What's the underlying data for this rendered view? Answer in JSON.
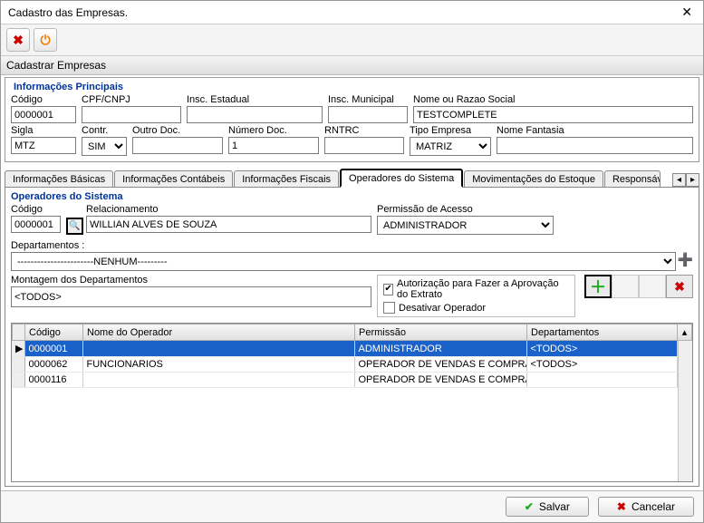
{
  "window": {
    "title": "Cadastro das Empresas."
  },
  "section_header": "Cadastrar Empresas",
  "fieldset_main": {
    "legend": "Informações Principais"
  },
  "labels": {
    "codigo": "Código",
    "cpf_cnpj": "CPF/CNPJ",
    "insc_estadual": "Insc. Estadual",
    "insc_municipal": "Insc. Municipal",
    "nome_razao": "Nome ou Razao Social",
    "sigla": "Sigla",
    "contr": "Contr.",
    "outro_doc": "Outro Doc.",
    "numero_doc": "Número Doc.",
    "rntrc": "RNTRC",
    "tipo_empresa": "Tipo Empresa",
    "nome_fantasia": "Nome Fantasia"
  },
  "values": {
    "codigo": "0000001",
    "cpf_cnpj": "",
    "insc_estadual": "",
    "insc_municipal": "",
    "nome_razao": "TESTCOMPLETE",
    "sigla": "MTZ",
    "contr": "SIM",
    "outro_doc": "",
    "numero_doc": "1",
    "rntrc": "",
    "tipo_empresa": "MATRIZ",
    "nome_fantasia": ""
  },
  "tabs": {
    "t1": "Informações Básicas",
    "t2": "Informações Contábeis",
    "t3": "Informações Fiscais",
    "t4": "Operadores do Sistema",
    "t5": "Movimentações do Estoque",
    "t6": "Responsáv"
  },
  "operators": {
    "legend": "Operadores do Sistema",
    "lbl_codigo": "Código",
    "lbl_relacionamento": "Relacionamento",
    "lbl_permissao": "Permissão de Acesso",
    "lbl_departamentos": "Departamentos :",
    "lbl_montagem": "Montagem dos Departamentos",
    "codigo": "0000001",
    "relacionamento": "WILLIAN ALVES DE SOUZA",
    "permissao": "ADMINISTRADOR",
    "departamento": "-----------------------NENHUM---------",
    "montagem": "<TODOS>",
    "chk_autorizacao_label": "Autorização para Fazer a Aprovação do Extrato",
    "chk_autorizacao_checked": true,
    "chk_desativar_label": "Desativar Operador",
    "chk_desativar_checked": false
  },
  "grid": {
    "headers": {
      "codigo": "Código",
      "nome": "Nome do Operador",
      "permissao": "Permissão",
      "departamentos": "Departamentos"
    },
    "rows": [
      {
        "codigo": "0000001",
        "nome": "",
        "permissao": "ADMINISTRADOR",
        "departamentos": "<TODOS>",
        "selected": true
      },
      {
        "codigo": "0000062",
        "nome": "FUNCIONARIOS",
        "permissao": "OPERADOR DE VENDAS E COMPRAS",
        "departamentos": "<TODOS>",
        "selected": false
      },
      {
        "codigo": "0000116",
        "nome": "",
        "permissao": "OPERADOR DE VENDAS E COMPRAS",
        "departamentos": "",
        "selected": false
      }
    ]
  },
  "footer": {
    "save": "Salvar",
    "cancel": "Cancelar"
  }
}
